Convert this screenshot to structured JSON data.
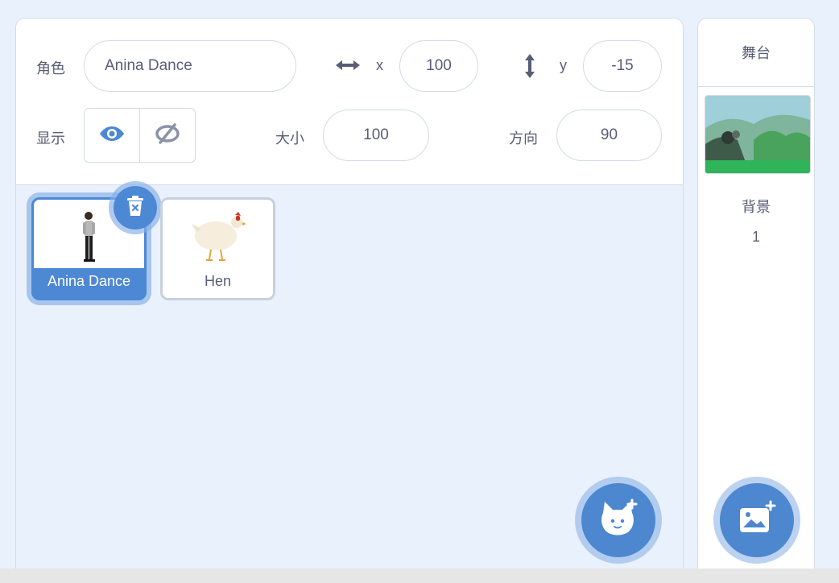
{
  "sprite_info": {
    "sprite_label": "角色",
    "sprite_name": "Anina Dance",
    "x_label": "x",
    "x_value": "100",
    "y_label": "y",
    "y_value": "-15",
    "show_label": "显示",
    "size_label": "大小",
    "size_value": "100",
    "direction_label": "方向",
    "direction_value": "90"
  },
  "sprites": [
    {
      "name": "Anina Dance",
      "selected": true
    },
    {
      "name": "Hen",
      "selected": false
    }
  ],
  "stage": {
    "title": "舞台",
    "backdrops_label": "背景",
    "backdrops_count": "1"
  },
  "icons": {
    "x_arrow": "horizontal-arrows-icon",
    "y_arrow": "vertical-arrows-icon",
    "show": "eye-icon",
    "hide": "eye-slash-icon",
    "delete": "trash-icon",
    "add_sprite": "cat-plus-icon",
    "add_backdrop": "image-plus-icon"
  },
  "colors": {
    "accent": "#4c88d4",
    "border": "#d3dbe8",
    "text": "#575e75",
    "pane_bg": "#e9f1fc"
  }
}
